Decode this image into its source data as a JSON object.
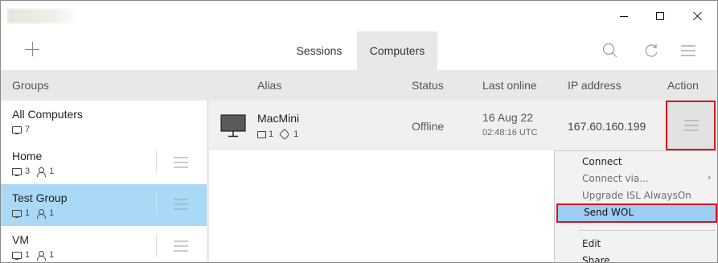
{
  "window": {
    "controls": {
      "minimize_icon": "minimize-icon",
      "maximize_icon": "maximize-icon",
      "close_icon": "close-icon"
    }
  },
  "toolbar": {
    "add_icon": "plus-icon",
    "tabs": [
      {
        "label": "Sessions",
        "active": false
      },
      {
        "label": "Computers",
        "active": true
      }
    ],
    "icons": [
      "search-icon",
      "refresh-icon",
      "menu-icon"
    ]
  },
  "header": {
    "groups": "Groups",
    "alias": "Alias",
    "status": "Status",
    "last_online": "Last online",
    "ip_address": "IP address",
    "action": "Action"
  },
  "groups": [
    {
      "name": "All Computers",
      "computers": "7",
      "users": null,
      "selected": false
    },
    {
      "name": "Home",
      "computers": "3",
      "users": "1",
      "selected": false
    },
    {
      "name": "Test Group",
      "computers": "1",
      "users": "1",
      "selected": true
    },
    {
      "name": "VM",
      "computers": "1",
      "users": "1",
      "selected": false
    }
  ],
  "computers": [
    {
      "alias": "MacMini",
      "folders": "1",
      "tags": "1",
      "status": "Offline",
      "last_online_date": "16 Aug 22",
      "last_online_time": "02:48:16 UTC",
      "ip": "167.60.160.199"
    }
  ],
  "context_menu": {
    "items": [
      {
        "label": "Connect",
        "enabled": true
      },
      {
        "label": "Connect via...",
        "enabled": false,
        "submenu": true
      },
      {
        "label": "Upgrade ISL AlwaysOn",
        "enabled": false
      },
      {
        "label": "Send WOL",
        "enabled": true,
        "highlighted": true
      },
      {
        "label": "Edit",
        "enabled": true
      },
      {
        "label": "Share",
        "enabled": true
      }
    ],
    "submenu_arrow": "›"
  },
  "colors": {
    "selected_group": "#aad8f7",
    "menu_highlight": "#9ecdf3",
    "highlight_border": "#d0191f",
    "header_bg": "#e8e8e8"
  }
}
